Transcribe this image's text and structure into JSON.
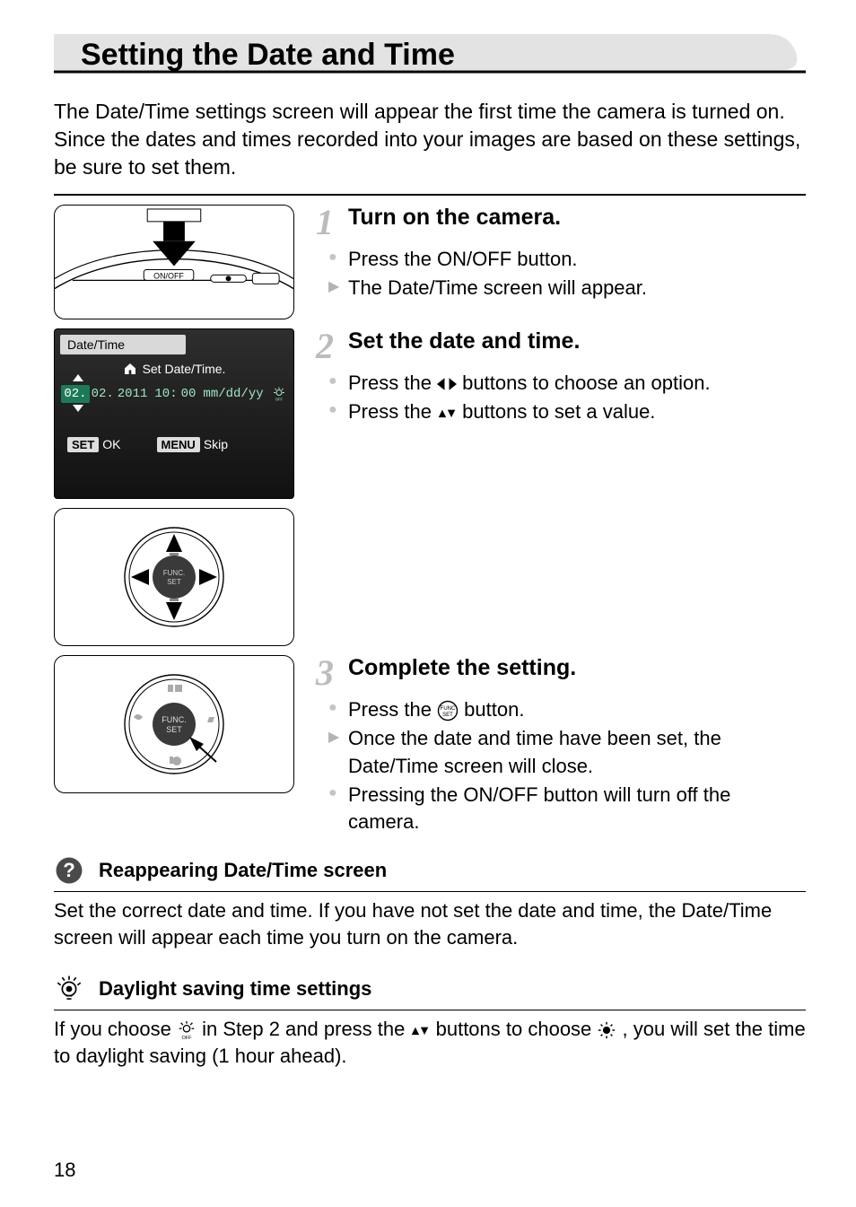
{
  "pageNumber": "18",
  "title": "Setting the Date and Time",
  "intro": "The Date/Time settings screen will appear the first time the camera is turned on. Since the dates and times recorded into your images are based on these settings, be sure to set them.",
  "steps": {
    "s1": {
      "num": "1",
      "title": "Turn on the camera.",
      "b1": "Press the ON/OFF button.",
      "b2": "The Date/Time screen will appear."
    },
    "s2": {
      "num": "2",
      "title": "Set the date and time.",
      "b1a": "Press the ",
      "b1b": " buttons to choose an option.",
      "b2a": "Press the ",
      "b2b": " buttons to set a value."
    },
    "s3": {
      "num": "3",
      "title": "Complete the setting.",
      "b1a": "Press the ",
      "b1b": " button.",
      "b2": "Once the date and time have been set, the Date/Time screen will close.",
      "b3": "Pressing the ON/OFF button will turn off the camera."
    }
  },
  "dtScreen": {
    "header": "Date/Time",
    "setLabel": "Set Date/Time.",
    "vals": {
      "m": "02.",
      "d": "02.",
      "y": "2011",
      "h": "10:",
      "mm": "00",
      "fmt": "mm/dd/yy"
    },
    "setBtn": "SET",
    "ok": "OK",
    "menuBtn": "MENU",
    "skip": "Skip"
  },
  "sub1": {
    "heading": "Reappearing Date/Time screen",
    "body": "Set the correct date and time. If you have not set the date and time, the Date/Time screen will appear each time you turn on the camera."
  },
  "sub2": {
    "heading": "Daylight saving time settings",
    "b1": "If you choose ",
    "b2": " in Step 2 and press the ",
    "b3": " buttons to choose ",
    "b4": ", you will set the time to daylight saving (1 hour ahead)."
  },
  "onoffLabel": "ON/OFF"
}
